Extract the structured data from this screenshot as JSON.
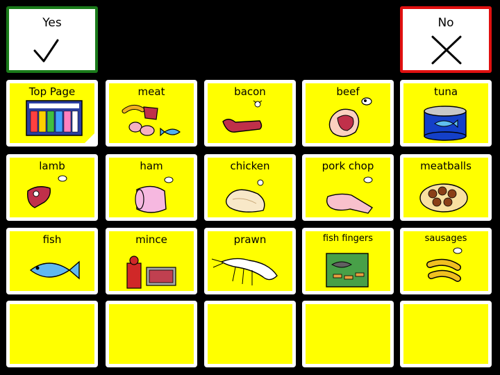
{
  "yes_label": "Yes",
  "no_label": "No",
  "cells": [
    {
      "label": "Top Page",
      "icon": "board-icon"
    },
    {
      "label": "meat",
      "icon": "meat-icon"
    },
    {
      "label": "bacon",
      "icon": "bacon-icon"
    },
    {
      "label": "beef",
      "icon": "beef-icon"
    },
    {
      "label": "tuna",
      "icon": "tuna-can-icon"
    },
    {
      "label": "lamb",
      "icon": "lamb-chop-icon"
    },
    {
      "label": "ham",
      "icon": "ham-icon"
    },
    {
      "label": "chicken",
      "icon": "chicken-breast-icon"
    },
    {
      "label": "pork chop",
      "icon": "pork-chop-icon"
    },
    {
      "label": "meatballs",
      "icon": "meatballs-icon"
    },
    {
      "label": "fish",
      "icon": "fish-icon"
    },
    {
      "label": "mince",
      "icon": "mincer-icon"
    },
    {
      "label": "prawn",
      "icon": "prawn-icon"
    },
    {
      "label": "fish fingers",
      "icon": "fish-fingers-box-icon"
    },
    {
      "label": "sausages",
      "icon": "sausages-icon"
    },
    {
      "label": "",
      "icon": ""
    },
    {
      "label": "",
      "icon": ""
    },
    {
      "label": "",
      "icon": ""
    },
    {
      "label": "",
      "icon": ""
    },
    {
      "label": "",
      "icon": ""
    }
  ],
  "colors": {
    "cell_fill": "#ffff00",
    "yes_border": "#1a7a1a",
    "no_border": "#e01010",
    "background": "#000000"
  }
}
